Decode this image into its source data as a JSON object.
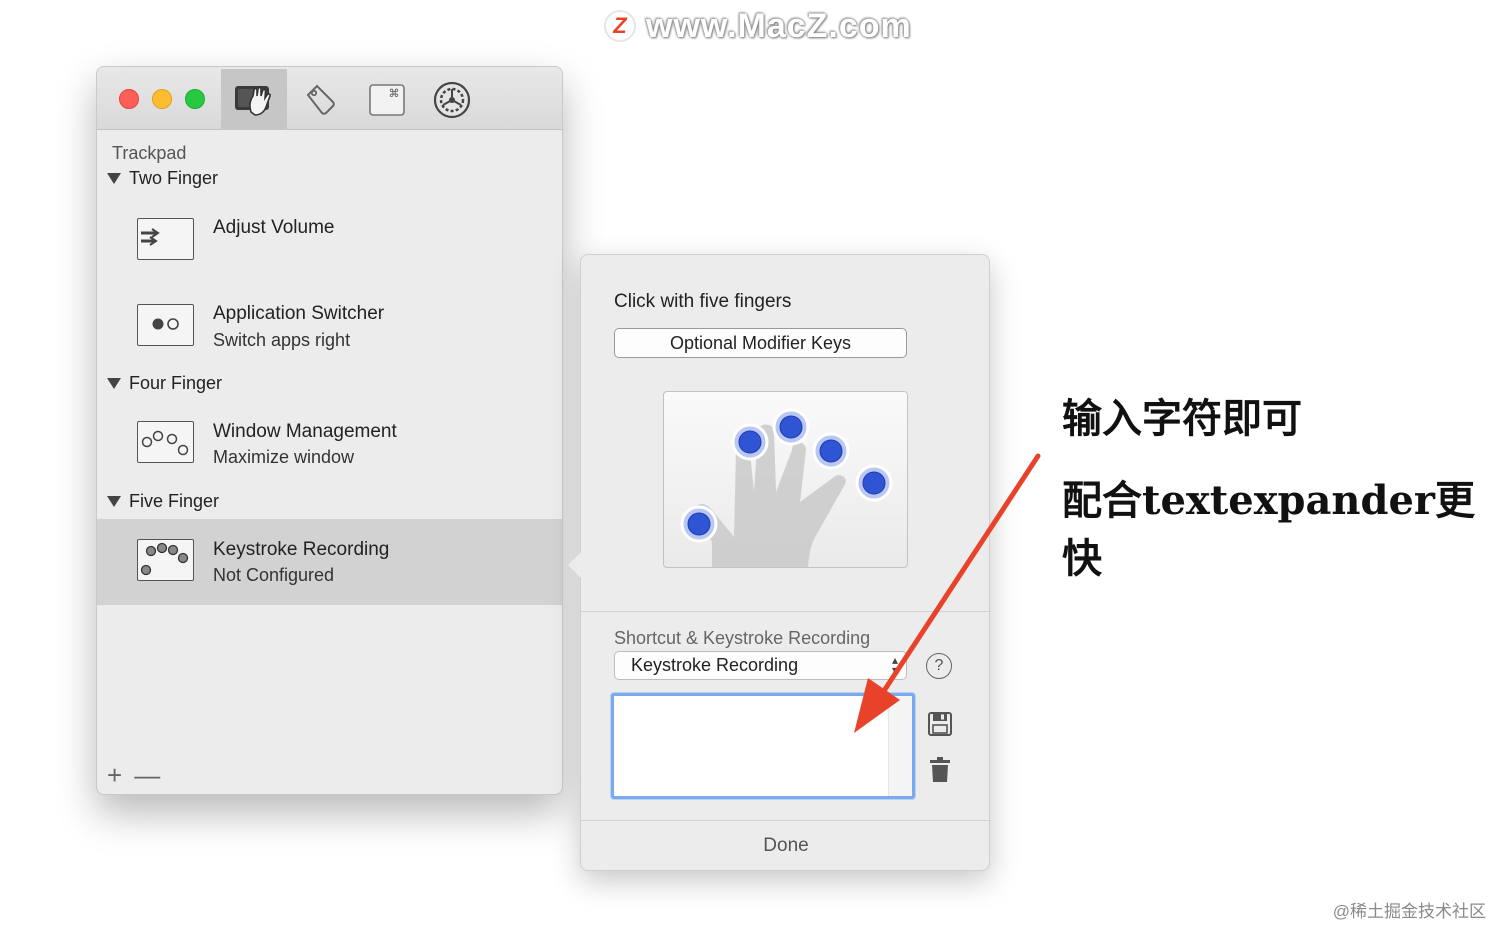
{
  "watermark": {
    "logo": "Z",
    "text": "www.MacZ.com"
  },
  "window": {
    "toolbar": {
      "tabs": [
        {
          "icon": "trackpad-hand-icon",
          "active": true
        },
        {
          "icon": "tag-icon",
          "active": false
        },
        {
          "icon": "command-key-icon",
          "active": false
        },
        {
          "icon": "settings-gear-icon",
          "active": false
        }
      ]
    },
    "section_title": "Trackpad",
    "groups": [
      {
        "label": "Two Finger",
        "items": [
          {
            "title": "Adjust Volume",
            "subtitle": ""
          },
          {
            "title": "Application Switcher",
            "subtitle": "Switch apps right"
          }
        ]
      },
      {
        "label": "Four Finger",
        "items": [
          {
            "title": "Window Management",
            "subtitle": "Maximize window"
          }
        ]
      },
      {
        "label": "Five Finger",
        "items": [
          {
            "title": "Keystroke Recording",
            "subtitle": "Not Configured",
            "selected": true
          }
        ]
      }
    ],
    "bottom_controls": {
      "add": "+",
      "remove": "—"
    }
  },
  "popover": {
    "title": "Click with five fingers",
    "modifier_button": "Optional Modifier Keys",
    "action_label": "Shortcut & Keystroke Recording",
    "action_select": "Keystroke Recording",
    "help": "?",
    "text_value": "",
    "done": "Done"
  },
  "annotation": {
    "line1": "输入字符即可",
    "line2": "配合textexpander更快",
    "accent_color": "#e8432a"
  },
  "footer_watermark": "@稀土掘金技术社区"
}
